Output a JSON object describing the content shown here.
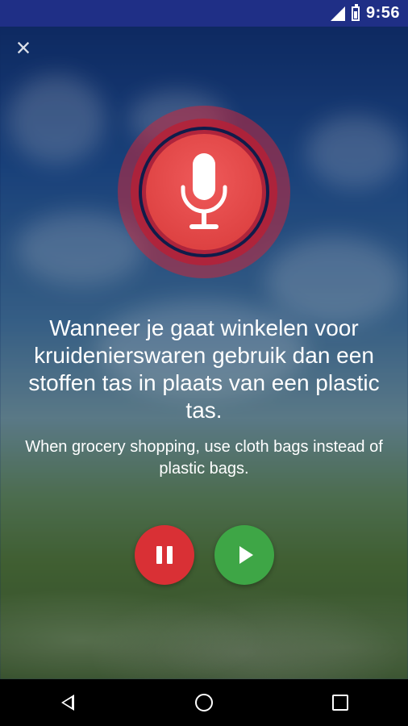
{
  "status_bar": {
    "time": "9:56",
    "icons": [
      "signal-icon",
      "battery-icon"
    ]
  },
  "close_icon": "×",
  "lesson": {
    "phrase": "Wanneer je gaat winkelen voor kruidenierswaren gebruik dan een stoffen tas in plaats van een plastic tas.",
    "translation": "When grocery shopping, use cloth bags instead of plastic bags."
  },
  "controls": {
    "pause_icon": "pause-icon",
    "play_icon": "play-icon"
  },
  "colors": {
    "status_bar": "#1f2f86",
    "mic": "#d83a3a",
    "pause": "#d93035",
    "play": "#3ea646"
  },
  "nav": [
    "back-icon",
    "home-icon",
    "recents-icon"
  ]
}
